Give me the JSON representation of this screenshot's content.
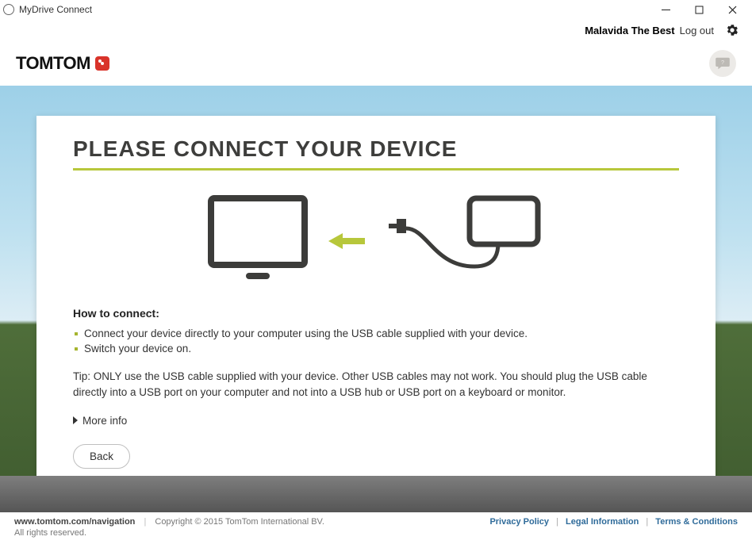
{
  "window": {
    "title": "MyDrive Connect"
  },
  "user": {
    "name": "Malavida The Best",
    "logout_label": "Log out"
  },
  "brand": {
    "name": "TOMTOM"
  },
  "card": {
    "heading": "PLEASE CONNECT YOUR DEVICE",
    "howto_heading": "How to connect:",
    "bullets": [
      "Connect your device directly to your computer using the USB cable supplied with your device.",
      "Switch your device on."
    ],
    "tip": "Tip: ONLY use the USB cable supplied with your device. Other USB cables may not work. You should plug the USB cable directly into a USB port on your computer and not into a USB hub or USB port on a keyboard or monitor.",
    "more_label": "More info",
    "back_label": "Back"
  },
  "footer": {
    "url": "www.tomtom.com/navigation",
    "copyright": "Copyright © 2015 TomTom International BV.",
    "rights": "All rights reserved.",
    "links": {
      "privacy": "Privacy Policy",
      "legal": "Legal Information",
      "terms": "Terms & Conditions"
    }
  }
}
